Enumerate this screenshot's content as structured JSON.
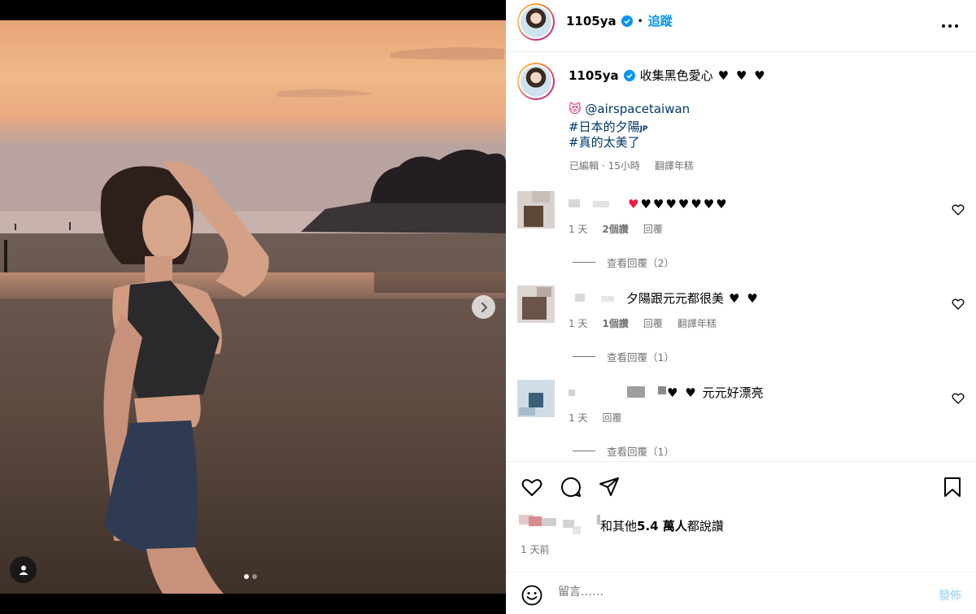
{
  "post": {
    "username": "1105ya",
    "follow_label": "追蹤",
    "separator": "•",
    "caption": "收集黑色愛心",
    "caption_hearts": "♥ ♥ ♥",
    "mention_emoji": "😻",
    "mention": "@airspacetaiwan",
    "hashtag_1": "#日本的夕陽",
    "hashtag_1_suffix": "JP",
    "hashtag_2": "#真的太美了",
    "edited_label": "已編輯",
    "edited_time": "· 15小時",
    "translate_label": "翻譯年糕"
  },
  "comments": [
    {
      "text": "♥♥♥♥♥♥♥",
      "red_heart": "♥",
      "age": "1 天",
      "likes": "2個讚",
      "reply_label": "回覆",
      "view_replies": "查看回覆（2）"
    },
    {
      "text": "夕陽跟元元都很美",
      "hearts": "♥ ♥",
      "age": "1 天",
      "likes": "1個讚",
      "reply_label": "回覆",
      "translate_label": "翻譯年糕",
      "view_replies": "查看回覆（1）"
    },
    {
      "hearts": "♥ ♥",
      "text": "元元好漂亮",
      "age": "1 天",
      "reply_label": "回覆",
      "view_replies": "查看回覆（1）"
    }
  ],
  "actions": {
    "likes_prefix": "和其他",
    "likes_count": "5.4 萬人",
    "likes_suffix": "都說讚",
    "time_ago": "1 天前"
  },
  "comment_box": {
    "placeholder": "留言……",
    "post_label": "發佈"
  },
  "carousel": {
    "total": 2,
    "active": 0
  },
  "colors": {
    "accent": "#0095f6",
    "link": "#00376b",
    "muted": "#737373",
    "heart_red": "#ed1c3c"
  },
  "icons": [
    "verified-badge-icon",
    "more-options-icon",
    "heart-icon",
    "comment-icon",
    "share-icon",
    "bookmark-icon",
    "emoji-icon",
    "chevron-right-icon",
    "user-tag-icon"
  ]
}
